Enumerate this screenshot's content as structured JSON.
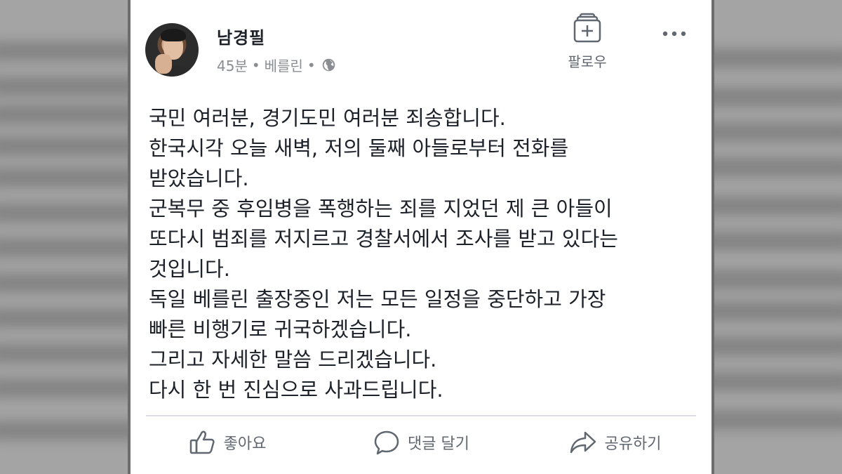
{
  "post": {
    "author": "남경필",
    "time": "45분",
    "separator": "•",
    "location": "베를린",
    "privacy_icon": "globe-icon",
    "follow_label": "팔로우",
    "more_icon": "more-horizontal-icon",
    "lines": [
      "국민 여러분, 경기도민 여러분 죄송합니다.",
      "한국시각 오늘 새벽, 저의 둘째 아들로부터 전화를",
      "받았습니다.",
      "군복무 중 후임병을 폭행하는 죄를 지었던 제 큰 아들이",
      "또다시 범죄를 저지르고 경찰서에서 조사를 받고 있다는",
      "것입니다.",
      "독일 베를린 출장중인 저는 모든 일정을 중단하고 가장",
      "빠른 비행기로 귀국하겠습니다.",
      "그리고 자세한 말씀 드리겠습니다.",
      "다시 한 번 진심으로 사과드립니다."
    ]
  },
  "actions": {
    "like": {
      "label": "좋아요",
      "icon": "thumbs-up-icon"
    },
    "comment": {
      "label": "댓글 달기",
      "icon": "comment-icon"
    },
    "share": {
      "label": "공유하기",
      "icon": "share-icon"
    }
  },
  "colors": {
    "text": "#1d2129",
    "secondary": "#606770",
    "meta": "#8a8d91",
    "divider": "#dadde1",
    "card": "#ffffff"
  }
}
